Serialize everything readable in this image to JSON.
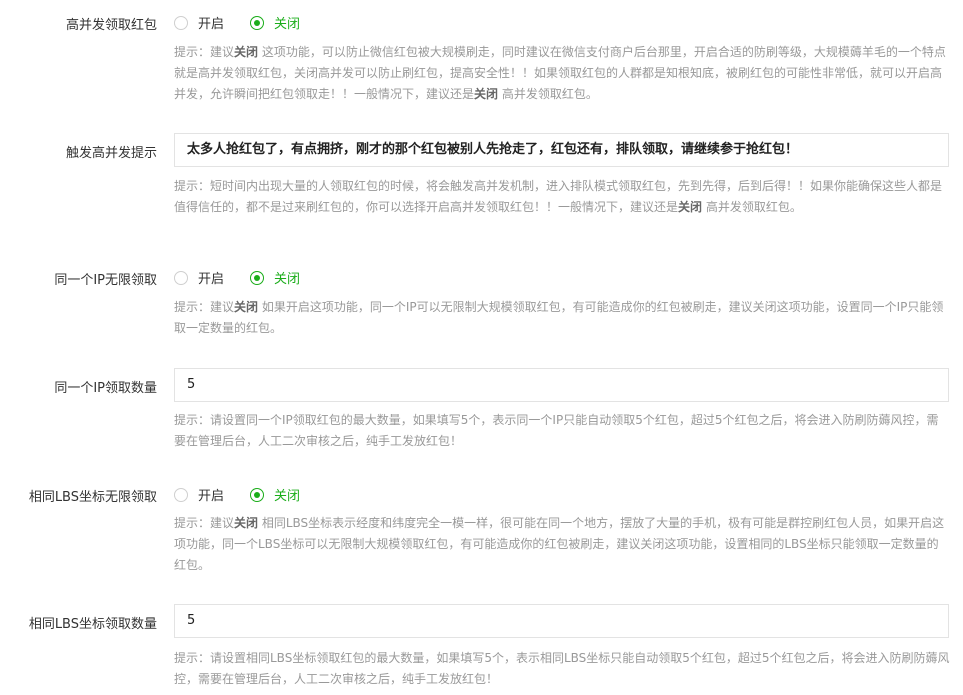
{
  "rows": [
    {
      "label": "高并发领取红包",
      "options": [
        "开启",
        "关闭"
      ],
      "selected": "关闭",
      "hint_prefix": "提示：建议",
      "hint_bold": "关闭",
      "hint_rest": " 这项功能，可以防止微信红包被大规模刷走，同时建议在微信支付商户后台那里，开启合适的防刷等级，大规模薅羊毛的一个特点就是高并发领取红包，关闭高并发可以防止刷红包，提高安全性！！如果领取红包的人群都是知根知底，被刷红包的可能性非常低，就可以开启高并发，允许瞬间把红包领取走！！一般情况下，建议还是",
      "hint_bold2": "关闭",
      "hint_end": " 高并发领取红包。"
    },
    {
      "label": "触发高并发提示",
      "value": "太多人抢红包了，有点拥挤，刚才的那个红包被别人先抢走了，红包还有，排队领取，请继续参于抢红包！",
      "hint_prefix": "提示：短时间内出现大量的人领取红包的时候，将会触发高并发机制，进入排队模式领取红包，先到先得，后到后得！！如果你能确保这些人都是值得信任的，都不是过来刷红包的，你可以选择开启高并发领取红包！！一般情况下，建议还是",
      "hint_bold": "关闭",
      "hint_rest": " 高并发领取红包。"
    },
    {
      "label": "同一个IP无限领取",
      "options": [
        "开启",
        "关闭"
      ],
      "selected": "关闭",
      "hint_prefix": "提示：建议",
      "hint_bold": "关闭",
      "hint_rest": " 如果开启这项功能，同一个IP可以无限制大规模领取红包，有可能造成你的红包被刷走，建议关闭这项功能，设置同一个IP只能领取一定数量的红包。"
    },
    {
      "label": "同一个IP领取数量",
      "value": "5",
      "hint_prefix": "提示：请设置同一个IP领取红包的最大数量，如果填写5个，表示同一个IP只能自动领取5个红包，超过5个红包之后，将会进入防刷防薅风控，需要在管理后台，人工二次审核之后，纯手工发放红包！"
    },
    {
      "label": "相同LBS坐标无限领取",
      "options": [
        "开启",
        "关闭"
      ],
      "selected": "关闭",
      "hint_prefix": "提示：建议",
      "hint_bold": "关闭",
      "hint_rest": " 相同LBS坐标表示经度和纬度完全一模一样，很可能在同一个地方，摆放了大量的手机，极有可能是群控刷红包人员，如果开启这项功能，同一个LBS坐标可以无限制大规模领取红包，有可能造成你的红包被刷走，建议关闭这项功能，设置相同的LBS坐标只能领取一定数量的红包。"
    },
    {
      "label": "相同LBS坐标领取数量",
      "value": "5",
      "hint_prefix": "提示：请设置相同LBS坐标领取红包的最大数量，如果填写5个，表示相同LBS坐标只能自动领取5个红包，超过5个红包之后，将会进入防刷防薅风控，需要在管理后台，人工二次审核之后，纯手工发放红包！"
    }
  ],
  "colors": {
    "accent": "#1aad19",
    "hint": "#999999",
    "border": "#e3e3e3"
  }
}
